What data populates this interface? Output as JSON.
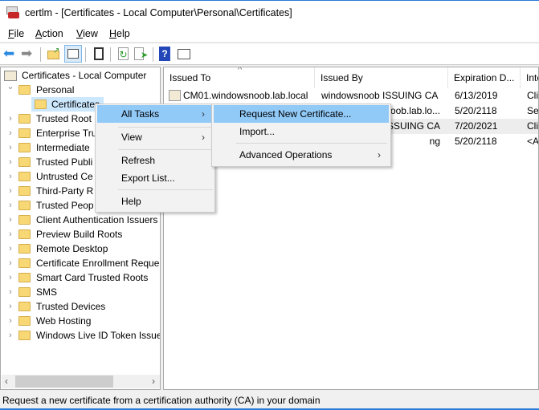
{
  "window": {
    "title": "certlm - [Certificates - Local Computer\\Personal\\Certificates]"
  },
  "menubar": [
    {
      "label": "File",
      "accel": "F"
    },
    {
      "label": "Action",
      "accel": "A"
    },
    {
      "label": "View",
      "accel": "V"
    },
    {
      "label": "Help",
      "accel": "H"
    }
  ],
  "toolbar": [
    "back-icon",
    "forward-icon",
    "up-folder-icon",
    "show-hide-console-tree-icon",
    "properties-icon",
    "refresh-icon",
    "export-list-icon",
    "help-icon",
    "show-action-pane-icon"
  ],
  "tree": {
    "root": "Certificates - Local Computer",
    "items": [
      {
        "label": "Personal",
        "expanded": true
      },
      {
        "label": "Certificates",
        "child": true,
        "selected": true
      },
      {
        "label": "Trusted Root"
      },
      {
        "label": "Enterprise Tru"
      },
      {
        "label": "Intermediate"
      },
      {
        "label": "Trusted Publi"
      },
      {
        "label": "Untrusted Ce"
      },
      {
        "label": "Third-Party R"
      },
      {
        "label": "Trusted Peop"
      },
      {
        "label": "Client Authentication Issuers"
      },
      {
        "label": "Preview Build Roots"
      },
      {
        "label": "Remote Desktop"
      },
      {
        "label": "Certificate Enrollment Reque"
      },
      {
        "label": "Smart Card Trusted Roots"
      },
      {
        "label": "SMS"
      },
      {
        "label": "Trusted Devices"
      },
      {
        "label": "Web Hosting"
      },
      {
        "label": "Windows Live ID Token Issuer"
      }
    ]
  },
  "table": {
    "columns": [
      "Issued To",
      "Issued By",
      "Expiration D...",
      "Inte"
    ],
    "rows": [
      [
        "CM01.windowsnoob.lab.local",
        "windowsnoob ISSUING CA",
        "6/13/2019",
        "Clie"
      ],
      [
        "",
        "oob.lab.lo...",
        "5/20/2118",
        "Ser"
      ],
      [
        "",
        "SSUING CA",
        "7/20/2021",
        "Clie"
      ],
      [
        "",
        "ng",
        "5/20/2118",
        "<A"
      ]
    ]
  },
  "context_menu": {
    "items": [
      "All Tasks",
      "View",
      "Refresh",
      "Export List...",
      "Help"
    ]
  },
  "submenu": {
    "items": [
      "Request New Certificate...",
      "Import...",
      "Advanced Operations"
    ]
  },
  "status": "Request a new certificate from a certification authority (CA) in your domain",
  "colors": {
    "highlight": "#91c9f7",
    "accent": "#2b7bd8"
  }
}
